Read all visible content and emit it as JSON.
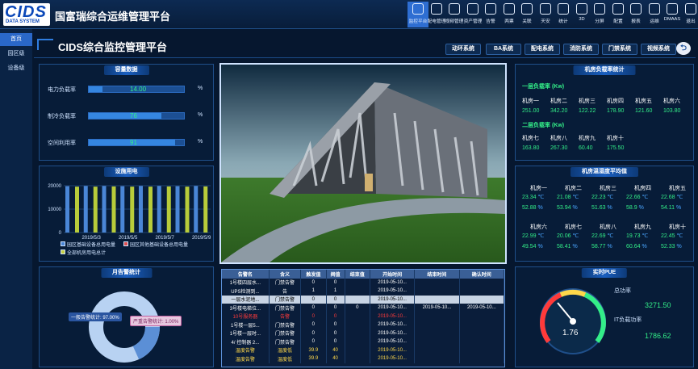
{
  "app": {
    "logo_top": "CIDS",
    "logo_bottom": "DATA SYSTEM",
    "title": "国富瑞综合运维管理平台"
  },
  "toolbar": [
    {
      "label": "监控平台",
      "icon": "monitor-icon",
      "active": true
    },
    {
      "label": "配电管理",
      "icon": "power-icon"
    },
    {
      "label": "视频管理",
      "icon": "video-icon"
    },
    {
      "label": "资产管理",
      "icon": "asset-icon"
    },
    {
      "label": "告警",
      "icon": "bell-icon"
    },
    {
      "label": "两票",
      "icon": "ticket-icon"
    },
    {
      "label": "关联",
      "icon": "link-icon"
    },
    {
      "label": "天安",
      "icon": "shield-icon"
    },
    {
      "label": "统计",
      "icon": "stats-icon"
    },
    {
      "label": "3D",
      "icon": "cube-icon"
    },
    {
      "label": "分屏",
      "icon": "split-icon"
    },
    {
      "label": "配置",
      "icon": "config-icon"
    },
    {
      "label": "报表",
      "icon": "report-icon"
    },
    {
      "label": "运维",
      "icon": "eye-icon"
    },
    {
      "label": "DMAAS",
      "icon": "heart-icon"
    },
    {
      "label": "退出",
      "icon": "power-off-icon"
    }
  ],
  "sidebar": [
    {
      "label": "首页",
      "active": true
    },
    {
      "label": "园区级"
    },
    {
      "label": "设备级"
    }
  ],
  "header": {
    "title": "CIDS综合监控管理平台",
    "tabs": [
      "动环系统",
      "BA系统",
      "配电系统",
      "消防系统",
      "门禁系统",
      "视频系统"
    ]
  },
  "capacity": {
    "title": "容量数据",
    "rows": [
      {
        "label": "电力负载率",
        "value": "14.00",
        "unit": "%",
        "fill": 0.14
      },
      {
        "label": "制冷负载率",
        "value": "76",
        "unit": "%",
        "fill": 0.76
      },
      {
        "label": "空间利用率",
        "value": "91",
        "unit": "%",
        "fill": 0.91
      }
    ]
  },
  "power": {
    "title": "设施用电",
    "y_ticks": [
      "20000",
      "10000",
      "0"
    ],
    "x_ticks": [
      "2019/5/3",
      "2019/5/5",
      "2019/5/7",
      "2019/5/9"
    ],
    "legend": [
      {
        "label": "园区基础设备总用电量",
        "color": "#4a86d6"
      },
      {
        "label": "园区其他基础设备总用电量",
        "color": "#e05050"
      },
      {
        "label": "全部机房用电总计",
        "color": "#c8d040"
      }
    ]
  },
  "chart_data": {
    "type": "bar",
    "categories": [
      "2019/5/2",
      "2019/5/3",
      "2019/5/4",
      "2019/5/5",
      "2019/5/6",
      "2019/5/7",
      "2019/5/8",
      "2019/5/9"
    ],
    "series": [
      {
        "name": "园区基础设备总用电量",
        "values": [
          19800,
          19900,
          19900,
          19800,
          19900,
          19900,
          19800,
          19900
        ]
      },
      {
        "name": "园区其他基础设备总用电量",
        "values": [
          0,
          0,
          0,
          0,
          0,
          0,
          0,
          0
        ]
      },
      {
        "name": "全部机房用电总计",
        "values": [
          19600,
          19600,
          19700,
          19600,
          19600,
          19700,
          19600,
          19700
        ]
      }
    ],
    "ylim": [
      0,
      20000
    ],
    "colors": {
      "blue": "#4a86d6",
      "green": "#b8cc3a"
    }
  },
  "alarm_stats": {
    "title": "月告警统计",
    "label_general": "一般告警统计: 97.00%",
    "label_severe": "严重告警统计: 1.00%"
  },
  "room_load": {
    "title": "机房负载率统计",
    "group1_title": "一层负载率  (Kw)",
    "group1": [
      {
        "name": "机房一",
        "value": "251.00"
      },
      {
        "name": "机房二",
        "value": "342.20"
      },
      {
        "name": "机房三",
        "value": "122.22"
      },
      {
        "name": "机房四",
        "value": "178.90"
      },
      {
        "name": "机房五",
        "value": "121.60"
      },
      {
        "name": "机房六",
        "value": "103.80"
      }
    ],
    "group2_title": "二层负载率  (Kw)",
    "group2": [
      {
        "name": "机房七",
        "value": "163.80"
      },
      {
        "name": "机房八",
        "value": "267.30"
      },
      {
        "name": "机房九",
        "value": "60.40"
      },
      {
        "name": "机房十",
        "value": "175.50"
      }
    ]
  },
  "temp_hum": {
    "title": "机房温湿度平均值",
    "rooms": [
      {
        "name": "机房一",
        "t": "23.34",
        "h": "52.88"
      },
      {
        "name": "机房二",
        "t": "21.08",
        "h": "53.94"
      },
      {
        "name": "机房三",
        "t": "22.23",
        "h": "51.63"
      },
      {
        "name": "机房四",
        "t": "22.66",
        "h": "58.9"
      },
      {
        "name": "机房五",
        "t": "22.68",
        "h": "54.11"
      },
      {
        "name": "机房六",
        "t": "22.99",
        "h": "49.54"
      },
      {
        "name": "机房七",
        "t": "20.06",
        "h": "58.41"
      },
      {
        "name": "机房八",
        "t": "22.69",
        "h": "58.77"
      },
      {
        "name": "机房九",
        "t": "19.73",
        "h": "60.64"
      },
      {
        "name": "机房十",
        "t": "22.45",
        "h": "52.33"
      }
    ],
    "t_unit": "℃",
    "h_unit": "%"
  },
  "alarm_table": {
    "columns": [
      "告警名",
      "含义",
      "触发值",
      "阀值",
      "结束值",
      "开始时间",
      "结束时间",
      "确认时间"
    ],
    "rows": [
      {
        "cells": [
          "1号楼四层水...",
          "门禁告警",
          "0",
          "0",
          "",
          "2019-05-10...",
          "",
          ""
        ]
      },
      {
        "cells": [
          "UPS检测到...",
          "告",
          "1",
          "1",
          "",
          "2019-05-10...",
          "",
          ""
        ]
      },
      {
        "cells": [
          "一层水泥地...",
          "门禁告警",
          "0",
          "0",
          "",
          "2019-05-10...",
          "",
          ""
        ],
        "state": "sel"
      },
      {
        "cells": [
          "3号楼电梯位...",
          "门禁告警",
          "0",
          "0",
          "0",
          "2019-05-10...",
          "2019-05-10...",
          "2019-05-10..."
        ]
      },
      {
        "cells": [
          "10号服务器",
          "告警",
          "0",
          "0",
          "",
          "2019-05-10...",
          "",
          ""
        ],
        "state": "red"
      },
      {
        "cells": [
          "1号楼一层5...",
          "门禁告警",
          "0",
          "0",
          "",
          "2019-05-10...",
          "",
          ""
        ]
      },
      {
        "cells": [
          "1号楼一层时...",
          "门禁告警",
          "0",
          "0",
          "",
          "2019-05-10...",
          "",
          ""
        ]
      },
      {
        "cells": [
          "4/ 控制器 2...",
          "门禁告警",
          "0",
          "0",
          "",
          "2019-05-10...",
          "",
          ""
        ]
      },
      {
        "cells": [
          "温度告警",
          "温度低",
          "39.9",
          "40",
          "",
          "2019-05-10...",
          "",
          ""
        ],
        "state": "yellow"
      },
      {
        "cells": [
          "温度告警",
          "温度低",
          "39.9",
          "40",
          "",
          "2019-05-10...",
          "",
          ""
        ],
        "state": "yellow"
      }
    ]
  },
  "pue": {
    "title": "实时PUE",
    "total_label": "总功率",
    "total_value": "3271.50",
    "it_label": "IT负载功率",
    "it_value": "1786.62",
    "gauge_value": "1.76"
  }
}
